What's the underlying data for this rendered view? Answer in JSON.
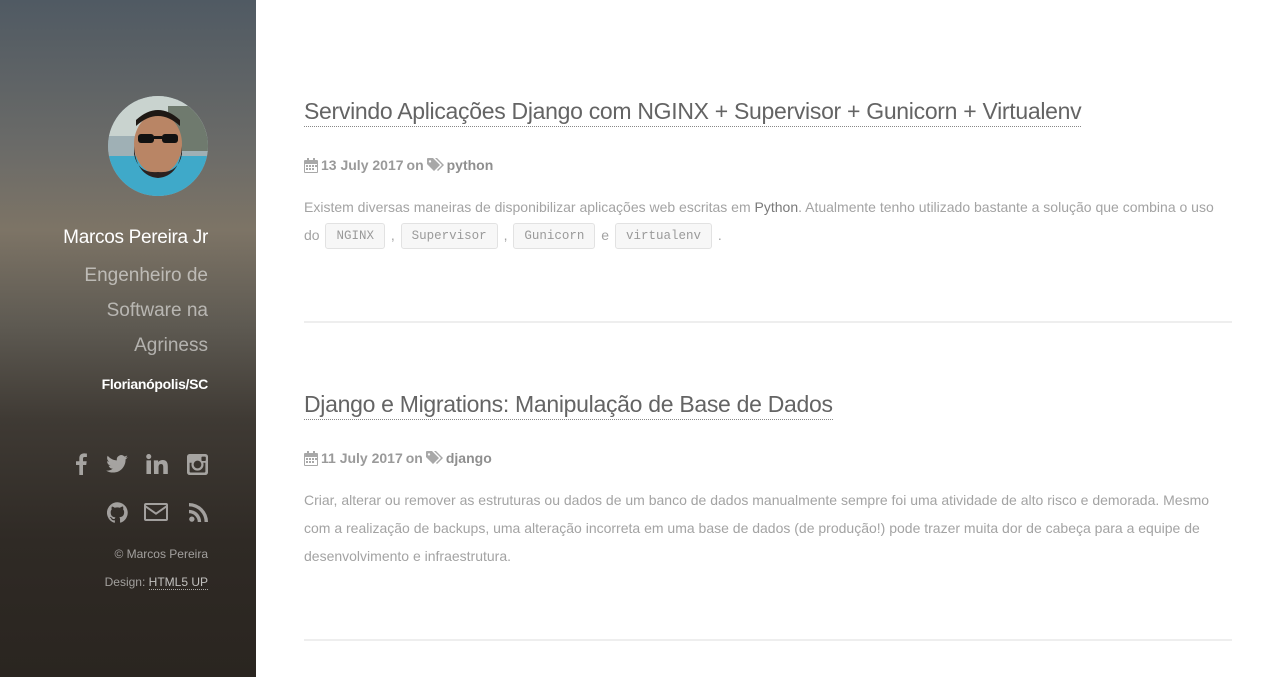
{
  "sidebar": {
    "author_name": "Marcos Pereira Jr",
    "author_role": "Engenheiro de Software na Agriness",
    "location": "Florianópolis/SC",
    "social_icons": [
      "facebook-icon",
      "twitter-icon",
      "linkedin-icon",
      "instagram-icon",
      "github-icon",
      "email-icon",
      "rss-icon"
    ],
    "copyright": "© Marcos Pereira",
    "design_label": "Design:",
    "design_link": "HTML5 UP"
  },
  "posts": [
    {
      "title": "Servindo Aplicações Django com NGINX + Supervisor + Gunicorn + Virtualenv",
      "date": "13 July 2017",
      "on": "on",
      "tag": "python",
      "body_1": "Existem diversas maneiras de disponibilizar aplicações web escritas em",
      "body_kw": "Python",
      "body_2": ". Atualmente tenho utilizado bastante a solução que combina o uso do",
      "code_1": "NGINX",
      "sep_1": ",",
      "code_2": "Supervisor",
      "sep_2": ",",
      "code_3": "Gunicorn",
      "sep_3": "e",
      "code_4": "virtualenv",
      "end": "."
    },
    {
      "title": "Django e Migrations: Manipulação de Base de Dados",
      "date": "11 July 2017",
      "on": "on",
      "tag": "django",
      "body": "Criar, alterar ou remover as estruturas ou dados de um banco de dados manualmente sempre foi uma atividade de alto risco e demorada. Mesmo com a realização de backups, uma alteração incorreta em uma base de dados (de produção!) pode trazer muita dor de cabeça para a equipe de desenvolvimento e infraestrutura."
    }
  ]
}
